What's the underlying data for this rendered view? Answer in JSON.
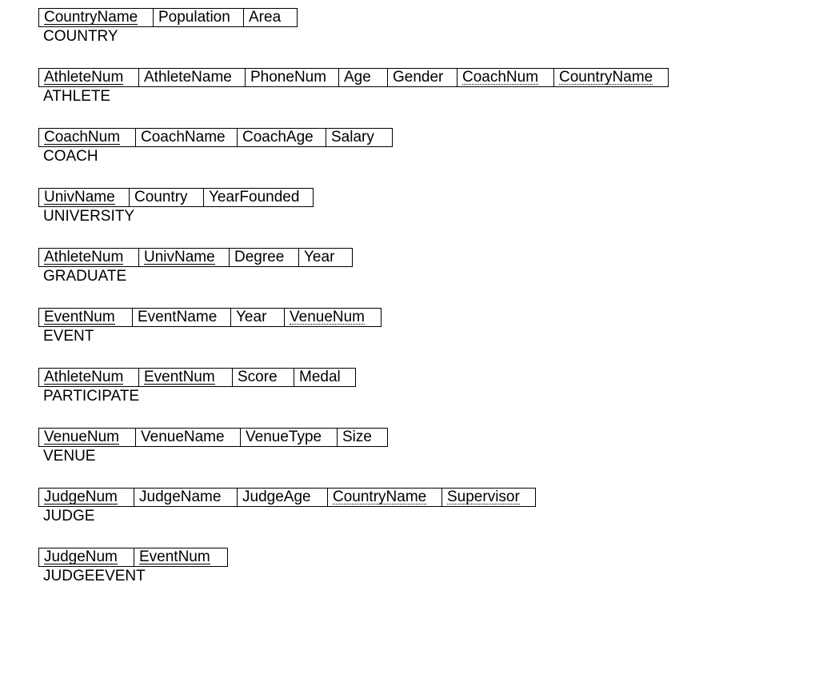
{
  "relations": [
    {
      "name": "COUNTRY",
      "attrs": [
        {
          "label": "CountryName",
          "role": "pk"
        },
        {
          "label": "Population",
          "role": ""
        },
        {
          "label": "Area",
          "role": ""
        }
      ]
    },
    {
      "name": "ATHLETE",
      "attrs": [
        {
          "label": "AthleteNum",
          "role": "pk"
        },
        {
          "label": "AthleteName",
          "role": ""
        },
        {
          "label": "PhoneNum",
          "role": ""
        },
        {
          "label": "Age",
          "role": ""
        },
        {
          "label": "Gender",
          "role": ""
        },
        {
          "label": "CoachNum",
          "role": "fk"
        },
        {
          "label": "CountryName",
          "role": "fk"
        }
      ]
    },
    {
      "name": "COACH",
      "attrs": [
        {
          "label": "CoachNum",
          "role": "pk"
        },
        {
          "label": "CoachName",
          "role": ""
        },
        {
          "label": "CoachAge",
          "role": ""
        },
        {
          "label": "Salary",
          "role": ""
        }
      ]
    },
    {
      "name": "UNIVERSITY",
      "attrs": [
        {
          "label": "UnivName",
          "role": "pk"
        },
        {
          "label": "Country",
          "role": ""
        },
        {
          "label": "YearFounded",
          "role": ""
        }
      ]
    },
    {
      "name": "GRADUATE",
      "attrs": [
        {
          "label": "AthleteNum",
          "role": "pkfk"
        },
        {
          "label": "UnivName",
          "role": "pkfk"
        },
        {
          "label": "Degree",
          "role": ""
        },
        {
          "label": "Year",
          "role": ""
        }
      ]
    },
    {
      "name": "EVENT",
      "attrs": [
        {
          "label": "EventNum",
          "role": "pk"
        },
        {
          "label": "EventName",
          "role": ""
        },
        {
          "label": "Year",
          "role": ""
        },
        {
          "label": "VenueNum",
          "role": "fk"
        }
      ]
    },
    {
      "name": "PARTICIPATE",
      "attrs": [
        {
          "label": "AthleteNum",
          "role": "pkfk"
        },
        {
          "label": "EventNum",
          "role": "pkfk"
        },
        {
          "label": "Score",
          "role": ""
        },
        {
          "label": "Medal",
          "role": ""
        }
      ]
    },
    {
      "name": "VENUE",
      "attrs": [
        {
          "label": "VenueNum",
          "role": "pk"
        },
        {
          "label": "VenueName",
          "role": ""
        },
        {
          "label": "VenueType",
          "role": ""
        },
        {
          "label": "Size",
          "role": ""
        }
      ]
    },
    {
      "name": "JUDGE",
      "attrs": [
        {
          "label": "JudgeNum",
          "role": "pk"
        },
        {
          "label": "JudgeName",
          "role": ""
        },
        {
          "label": "JudgeAge",
          "role": ""
        },
        {
          "label": "CountryName",
          "role": "fk"
        },
        {
          "label": "Supervisor",
          "role": "fk"
        }
      ]
    },
    {
      "name": "JUDGEEVENT",
      "attrs": [
        {
          "label": "JudgeNum",
          "role": "pkfk"
        },
        {
          "label": "EventNum",
          "role": "pkfk"
        }
      ]
    }
  ],
  "widths": {
    "CountryName": 130,
    "Population": 100,
    "Area": 54,
    "AthleteNum": 112,
    "AthleteName": 120,
    "PhoneNum": 104,
    "Age": 48,
    "Gender": 74,
    "CoachNum": 108,
    "CoachName": 114,
    "CoachAge": 98,
    "Salary": 70,
    "UnivName": 100,
    "Country": 80,
    "YearFounded": 124,
    "Degree": 74,
    "Year": 54,
    "EventNum": 104,
    "EventName": 110,
    "VenueNum": 108,
    "Score": 64,
    "Medal": 64,
    "VenueName": 118,
    "VenueType": 108,
    "Size": 50,
    "JudgeNum": 106,
    "JudgeName": 116,
    "JudgeAge": 100,
    "Supervisor": 104
  }
}
